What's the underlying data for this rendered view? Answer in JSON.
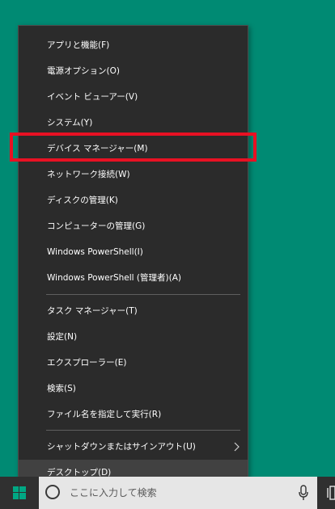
{
  "menu": {
    "items": [
      {
        "label": "アプリと機能(F)"
      },
      {
        "label": "電源オプション(O)"
      },
      {
        "label": "イベント ビューアー(V)"
      },
      {
        "label": "システム(Y)"
      },
      {
        "label": "デバイス マネージャー(M)"
      },
      {
        "label": "ネットワーク接続(W)"
      },
      {
        "label": "ディスクの管理(K)"
      },
      {
        "label": "コンピューターの管理(G)"
      },
      {
        "label": "Windows PowerShell(I)"
      },
      {
        "label": "Windows PowerShell (管理者)(A)"
      },
      {
        "label": "タスク マネージャー(T)"
      },
      {
        "label": "設定(N)"
      },
      {
        "label": "エクスプローラー(E)"
      },
      {
        "label": "検索(S)"
      },
      {
        "label": "ファイル名を指定して実行(R)"
      },
      {
        "label": "シャットダウンまたはサインアウト(U)"
      },
      {
        "label": "デスクトップ(D)"
      }
    ],
    "highlighted_item": "デバイス マネージャー(M)"
  },
  "taskbar": {
    "search_placeholder": "ここに入力して検索"
  },
  "colors": {
    "desktop": "#008a73",
    "menu_bg": "#2b2b2b",
    "highlight_box": "#e81123",
    "taskbar": "#303030",
    "start_icon": "#00a884"
  },
  "icons": [
    "chevron-right-icon",
    "windows-logo-icon",
    "search-circle-icon",
    "microphone-icon",
    "task-view-icon"
  ]
}
